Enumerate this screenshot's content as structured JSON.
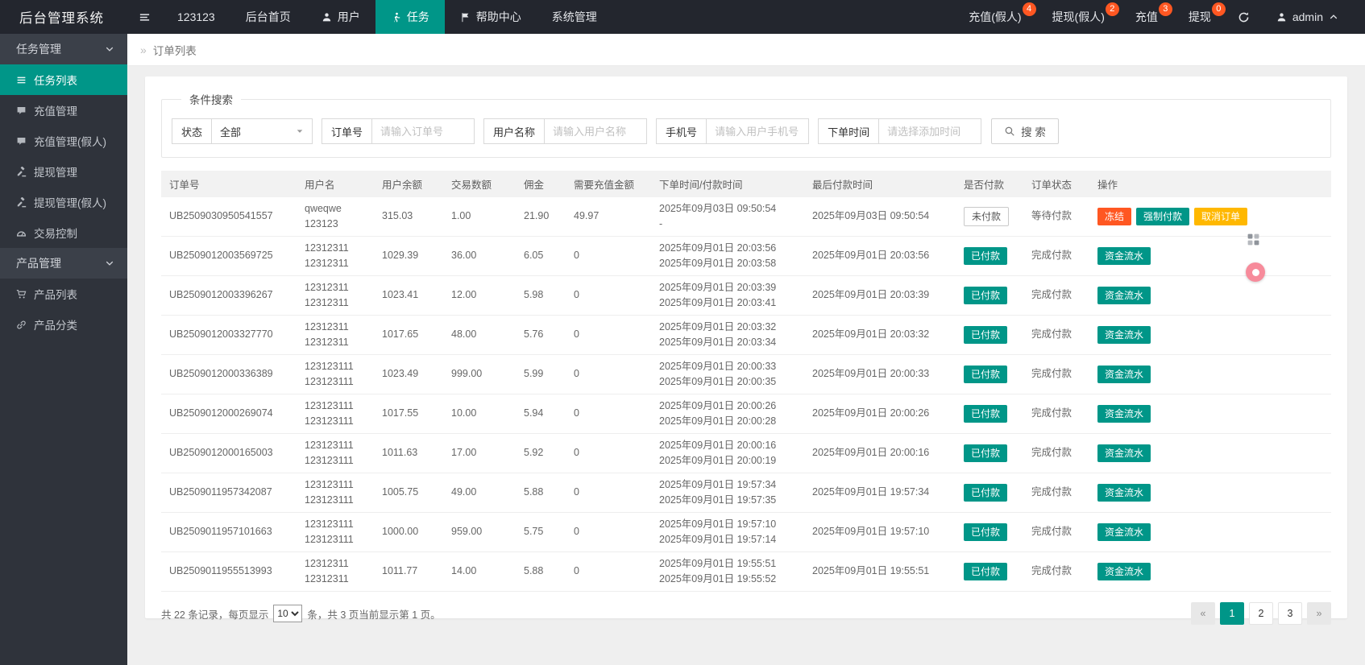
{
  "colors": {
    "accent": "#009688",
    "badge": "#ff5722",
    "red": "#ff5722",
    "teal": "#009688",
    "yellow": "#ffb800"
  },
  "topbar": {
    "title": "后台管理系统",
    "menu": [
      {
        "label": "123123",
        "icon": null,
        "active": false
      },
      {
        "label": "后台首页",
        "icon": null,
        "active": false
      },
      {
        "label": "用户",
        "icon": "user",
        "active": false
      },
      {
        "label": "任务",
        "icon": "task",
        "active": true
      },
      {
        "label": "帮助中心",
        "icon": "flag",
        "active": false
      },
      {
        "label": "系统管理",
        "icon": null,
        "active": false
      }
    ],
    "right_items": [
      {
        "label": "充值(假人)",
        "badge": "4"
      },
      {
        "label": "提现(假人)",
        "badge": "2"
      },
      {
        "label": "充值",
        "badge": "3"
      },
      {
        "label": "提现",
        "badge": "0"
      }
    ],
    "user": {
      "name": "admin"
    }
  },
  "sidebar": {
    "groups": [
      {
        "label": "任务管理",
        "expanded": true,
        "items": [
          {
            "label": "任务列表",
            "icon": "list",
            "active": true
          },
          {
            "label": "充值管理",
            "icon": "comment",
            "active": false
          },
          {
            "label": "充值管理(假人)",
            "icon": "comment",
            "active": false
          },
          {
            "label": "提现管理",
            "icon": "gavel",
            "active": false
          },
          {
            "label": "提现管理(假人)",
            "icon": "gavel",
            "active": false
          },
          {
            "label": "交易控制",
            "icon": "gauge",
            "active": false
          }
        ]
      },
      {
        "label": "产品管理",
        "expanded": true,
        "items": [
          {
            "label": "产品列表",
            "icon": "cart",
            "active": false
          },
          {
            "label": "产品分类",
            "icon": "link",
            "active": false
          }
        ]
      }
    ]
  },
  "breadcrumb": {
    "icon": "»",
    "label": "订单列表"
  },
  "search": {
    "legend": "条件搜索",
    "fields": [
      {
        "label": "状态",
        "type": "select",
        "value": "全部"
      },
      {
        "label": "订单号",
        "type": "text",
        "placeholder": "请输入订单号"
      },
      {
        "label": "用户名称",
        "type": "text",
        "placeholder": "请输入用户名称"
      },
      {
        "label": "手机号",
        "type": "text",
        "placeholder": "请输入用户手机号"
      },
      {
        "label": "下单时间",
        "type": "text",
        "placeholder": "请选择添加时间"
      }
    ],
    "button_label": "搜 索"
  },
  "table": {
    "headers": [
      "订单号",
      "用户名",
      "用户余额",
      "交易数额",
      "佣金",
      "需要充值金额",
      "下单时间/付款时间",
      "最后付款时间",
      "是否付款",
      "订单状态",
      "操作"
    ],
    "rows": [
      {
        "order_no": "UB2509030950541557",
        "user_lines": [
          "qweqwe",
          "123123"
        ],
        "balance": "315.03",
        "amount": "1.00",
        "commission": "21.90",
        "need_recharge": "49.97",
        "order_times": [
          "2025年09月03日 09:50:54",
          "-"
        ],
        "last_pay_time": "2025年09月03日 09:50:54",
        "paid": {
          "label": "未付款",
          "style": "outline"
        },
        "status": "等待付款",
        "actions": [
          {
            "label": "冻结",
            "color": "red"
          },
          {
            "label": "强制付款",
            "color": "teal"
          },
          {
            "label": "取消订单",
            "color": "yellow"
          }
        ]
      },
      {
        "order_no": "UB2509012003569725",
        "user_lines": [
          "12312311",
          "12312311"
        ],
        "balance": "1029.39",
        "amount": "36.00",
        "commission": "6.05",
        "need_recharge": "0",
        "order_times": [
          "2025年09月01日 20:03:56",
          "2025年09月01日 20:03:58"
        ],
        "last_pay_time": "2025年09月01日 20:03:56",
        "paid": {
          "label": "已付款",
          "style": "solid"
        },
        "status": "完成付款",
        "actions": [
          {
            "label": "资金流水",
            "color": "teal"
          }
        ]
      },
      {
        "order_no": "UB2509012003396267",
        "user_lines": [
          "12312311",
          "12312311"
        ],
        "balance": "1023.41",
        "amount": "12.00",
        "commission": "5.98",
        "need_recharge": "0",
        "order_times": [
          "2025年09月01日 20:03:39",
          "2025年09月01日 20:03:41"
        ],
        "last_pay_time": "2025年09月01日 20:03:39",
        "paid": {
          "label": "已付款",
          "style": "solid"
        },
        "status": "完成付款",
        "actions": [
          {
            "label": "资金流水",
            "color": "teal"
          }
        ]
      },
      {
        "order_no": "UB2509012003327770",
        "user_lines": [
          "12312311",
          "12312311"
        ],
        "balance": "1017.65",
        "amount": "48.00",
        "commission": "5.76",
        "need_recharge": "0",
        "order_times": [
          "2025年09月01日 20:03:32",
          "2025年09月01日 20:03:34"
        ],
        "last_pay_time": "2025年09月01日 20:03:32",
        "paid": {
          "label": "已付款",
          "style": "solid"
        },
        "status": "完成付款",
        "actions": [
          {
            "label": "资金流水",
            "color": "teal"
          }
        ]
      },
      {
        "order_no": "UB2509012000336389",
        "user_lines": [
          "123123111",
          "123123111"
        ],
        "balance": "1023.49",
        "amount": "999.00",
        "commission": "5.99",
        "need_recharge": "0",
        "order_times": [
          "2025年09月01日 20:00:33",
          "2025年09月01日 20:00:35"
        ],
        "last_pay_time": "2025年09月01日 20:00:33",
        "paid": {
          "label": "已付款",
          "style": "solid"
        },
        "status": "完成付款",
        "actions": [
          {
            "label": "资金流水",
            "color": "teal"
          }
        ]
      },
      {
        "order_no": "UB2509012000269074",
        "user_lines": [
          "123123111",
          "123123111"
        ],
        "balance": "1017.55",
        "amount": "10.00",
        "commission": "5.94",
        "need_recharge": "0",
        "order_times": [
          "2025年09月01日 20:00:26",
          "2025年09月01日 20:00:28"
        ],
        "last_pay_time": "2025年09月01日 20:00:26",
        "paid": {
          "label": "已付款",
          "style": "solid"
        },
        "status": "完成付款",
        "actions": [
          {
            "label": "资金流水",
            "color": "teal"
          }
        ]
      },
      {
        "order_no": "UB2509012000165003",
        "user_lines": [
          "123123111",
          "123123111"
        ],
        "balance": "1011.63",
        "amount": "17.00",
        "commission": "5.92",
        "need_recharge": "0",
        "order_times": [
          "2025年09月01日 20:00:16",
          "2025年09月01日 20:00:19"
        ],
        "last_pay_time": "2025年09月01日 20:00:16",
        "paid": {
          "label": "已付款",
          "style": "solid"
        },
        "status": "完成付款",
        "actions": [
          {
            "label": "资金流水",
            "color": "teal"
          }
        ]
      },
      {
        "order_no": "UB2509011957342087",
        "user_lines": [
          "123123111",
          "123123111"
        ],
        "balance": "1005.75",
        "amount": "49.00",
        "commission": "5.88",
        "need_recharge": "0",
        "order_times": [
          "2025年09月01日 19:57:34",
          "2025年09月01日 19:57:35"
        ],
        "last_pay_time": "2025年09月01日 19:57:34",
        "paid": {
          "label": "已付款",
          "style": "solid"
        },
        "status": "完成付款",
        "actions": [
          {
            "label": "资金流水",
            "color": "teal"
          }
        ]
      },
      {
        "order_no": "UB2509011957101663",
        "user_lines": [
          "123123111",
          "123123111"
        ],
        "balance": "1000.00",
        "amount": "959.00",
        "commission": "5.75",
        "need_recharge": "0",
        "order_times": [
          "2025年09月01日 19:57:10",
          "2025年09月01日 19:57:14"
        ],
        "last_pay_time": "2025年09月01日 19:57:10",
        "paid": {
          "label": "已付款",
          "style": "solid"
        },
        "status": "完成付款",
        "actions": [
          {
            "label": "资金流水",
            "color": "teal"
          }
        ]
      },
      {
        "order_no": "UB2509011955513993",
        "user_lines": [
          "12312311",
          "12312311"
        ],
        "balance": "1011.77",
        "amount": "14.00",
        "commission": "5.88",
        "need_recharge": "0",
        "order_times": [
          "2025年09月01日 19:55:51",
          "2025年09月01日 19:55:52"
        ],
        "last_pay_time": "2025年09月01日 19:55:51",
        "paid": {
          "label": "已付款",
          "style": "solid"
        },
        "status": "完成付款",
        "actions": [
          {
            "label": "资金流水",
            "color": "teal"
          }
        ]
      }
    ]
  },
  "footer": {
    "summary_prefix": "共 22 条记录，每页显示",
    "page_size": "10",
    "summary_suffix": "条，共 3 页当前显示第 1 页。",
    "pagination": [
      {
        "label": "«",
        "state": "disabled"
      },
      {
        "label": "1",
        "state": "active"
      },
      {
        "label": "2",
        "state": "normal"
      },
      {
        "label": "3",
        "state": "normal"
      },
      {
        "label": "»",
        "state": "disabled"
      }
    ]
  }
}
